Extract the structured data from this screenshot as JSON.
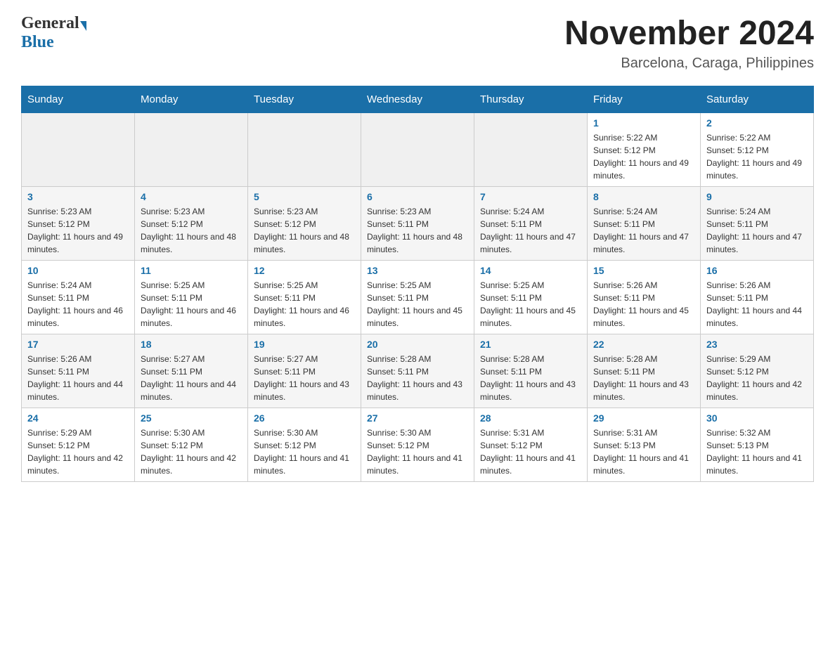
{
  "header": {
    "logo_general": "General",
    "logo_blue": "Blue",
    "month_year": "November 2024",
    "location": "Barcelona, Caraga, Philippines"
  },
  "weekdays": [
    "Sunday",
    "Monday",
    "Tuesday",
    "Wednesday",
    "Thursday",
    "Friday",
    "Saturday"
  ],
  "weeks": [
    {
      "days": [
        {
          "number": "",
          "info": "",
          "empty": true
        },
        {
          "number": "",
          "info": "",
          "empty": true
        },
        {
          "number": "",
          "info": "",
          "empty": true
        },
        {
          "number": "",
          "info": "",
          "empty": true
        },
        {
          "number": "",
          "info": "",
          "empty": true
        },
        {
          "number": "1",
          "info": "Sunrise: 5:22 AM\nSunset: 5:12 PM\nDaylight: 11 hours and 49 minutes."
        },
        {
          "number": "2",
          "info": "Sunrise: 5:22 AM\nSunset: 5:12 PM\nDaylight: 11 hours and 49 minutes."
        }
      ]
    },
    {
      "days": [
        {
          "number": "3",
          "info": "Sunrise: 5:23 AM\nSunset: 5:12 PM\nDaylight: 11 hours and 49 minutes."
        },
        {
          "number": "4",
          "info": "Sunrise: 5:23 AM\nSunset: 5:12 PM\nDaylight: 11 hours and 48 minutes."
        },
        {
          "number": "5",
          "info": "Sunrise: 5:23 AM\nSunset: 5:12 PM\nDaylight: 11 hours and 48 minutes."
        },
        {
          "number": "6",
          "info": "Sunrise: 5:23 AM\nSunset: 5:11 PM\nDaylight: 11 hours and 48 minutes."
        },
        {
          "number": "7",
          "info": "Sunrise: 5:24 AM\nSunset: 5:11 PM\nDaylight: 11 hours and 47 minutes."
        },
        {
          "number": "8",
          "info": "Sunrise: 5:24 AM\nSunset: 5:11 PM\nDaylight: 11 hours and 47 minutes."
        },
        {
          "number": "9",
          "info": "Sunrise: 5:24 AM\nSunset: 5:11 PM\nDaylight: 11 hours and 47 minutes."
        }
      ]
    },
    {
      "days": [
        {
          "number": "10",
          "info": "Sunrise: 5:24 AM\nSunset: 5:11 PM\nDaylight: 11 hours and 46 minutes."
        },
        {
          "number": "11",
          "info": "Sunrise: 5:25 AM\nSunset: 5:11 PM\nDaylight: 11 hours and 46 minutes."
        },
        {
          "number": "12",
          "info": "Sunrise: 5:25 AM\nSunset: 5:11 PM\nDaylight: 11 hours and 46 minutes."
        },
        {
          "number": "13",
          "info": "Sunrise: 5:25 AM\nSunset: 5:11 PM\nDaylight: 11 hours and 45 minutes."
        },
        {
          "number": "14",
          "info": "Sunrise: 5:25 AM\nSunset: 5:11 PM\nDaylight: 11 hours and 45 minutes."
        },
        {
          "number": "15",
          "info": "Sunrise: 5:26 AM\nSunset: 5:11 PM\nDaylight: 11 hours and 45 minutes."
        },
        {
          "number": "16",
          "info": "Sunrise: 5:26 AM\nSunset: 5:11 PM\nDaylight: 11 hours and 44 minutes."
        }
      ]
    },
    {
      "days": [
        {
          "number": "17",
          "info": "Sunrise: 5:26 AM\nSunset: 5:11 PM\nDaylight: 11 hours and 44 minutes."
        },
        {
          "number": "18",
          "info": "Sunrise: 5:27 AM\nSunset: 5:11 PM\nDaylight: 11 hours and 44 minutes."
        },
        {
          "number": "19",
          "info": "Sunrise: 5:27 AM\nSunset: 5:11 PM\nDaylight: 11 hours and 43 minutes."
        },
        {
          "number": "20",
          "info": "Sunrise: 5:28 AM\nSunset: 5:11 PM\nDaylight: 11 hours and 43 minutes."
        },
        {
          "number": "21",
          "info": "Sunrise: 5:28 AM\nSunset: 5:11 PM\nDaylight: 11 hours and 43 minutes."
        },
        {
          "number": "22",
          "info": "Sunrise: 5:28 AM\nSunset: 5:11 PM\nDaylight: 11 hours and 43 minutes."
        },
        {
          "number": "23",
          "info": "Sunrise: 5:29 AM\nSunset: 5:12 PM\nDaylight: 11 hours and 42 minutes."
        }
      ]
    },
    {
      "days": [
        {
          "number": "24",
          "info": "Sunrise: 5:29 AM\nSunset: 5:12 PM\nDaylight: 11 hours and 42 minutes."
        },
        {
          "number": "25",
          "info": "Sunrise: 5:30 AM\nSunset: 5:12 PM\nDaylight: 11 hours and 42 minutes."
        },
        {
          "number": "26",
          "info": "Sunrise: 5:30 AM\nSunset: 5:12 PM\nDaylight: 11 hours and 41 minutes."
        },
        {
          "number": "27",
          "info": "Sunrise: 5:30 AM\nSunset: 5:12 PM\nDaylight: 11 hours and 41 minutes."
        },
        {
          "number": "28",
          "info": "Sunrise: 5:31 AM\nSunset: 5:12 PM\nDaylight: 11 hours and 41 minutes."
        },
        {
          "number": "29",
          "info": "Sunrise: 5:31 AM\nSunset: 5:13 PM\nDaylight: 11 hours and 41 minutes."
        },
        {
          "number": "30",
          "info": "Sunrise: 5:32 AM\nSunset: 5:13 PM\nDaylight: 11 hours and 41 minutes."
        }
      ]
    }
  ]
}
